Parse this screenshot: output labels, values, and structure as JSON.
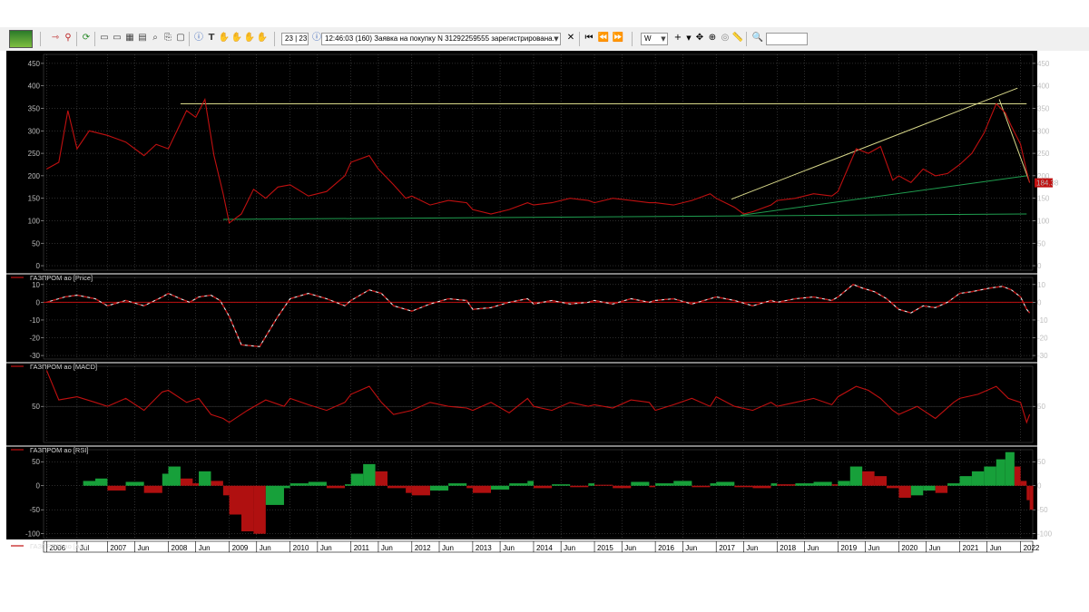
{
  "toolbar": {
    "icons": [
      "app-logo-icon",
      "arrow-right-icon",
      "link-icon",
      "refresh-icon",
      "window-icon",
      "window-icon",
      "table-icon",
      "chart-icon",
      "search-doc-icon",
      "export-icon",
      "info-icon",
      "text-icon",
      "hand-icon",
      "hand-icon",
      "hand-icon"
    ],
    "counter": "23 | 23",
    "status_message": "12:46:03  (160) Заявка на покупку N 31292259555 зарегистрирована.",
    "nav_icons": [
      "first-icon",
      "prev-icon",
      "next-icon"
    ],
    "period": "W",
    "tool_icons": [
      "crosshair-icon",
      "dropdown-icon",
      "move-icon",
      "target-icon",
      "circle-icon",
      "ruler-icon"
    ],
    "zoom_icon": "zoom-icon",
    "search_value": ""
  },
  "colors": {
    "background": "#000000",
    "price": "#c01010",
    "indicator": "#e8e8e8",
    "green_line": "#1f9d4f",
    "yellow_line": "#d8d88a",
    "ao_up": "#17a03a",
    "ao_down": "#b01010",
    "divider": "#d0d0d0"
  },
  "panels": [
    {
      "id": "price",
      "legend": "ГАЗПРОМ ао [Price]",
      "ticks": [
        0,
        50,
        100,
        150,
        200,
        250,
        300,
        350,
        400,
        450
      ],
      "ylim": [
        -10,
        470
      ],
      "last_price_label": "184.38"
    },
    {
      "id": "macd",
      "legend": "ГАЗПРОМ ао [MACD]",
      "ticks": [
        10,
        0,
        -10,
        -20,
        -30
      ],
      "ylim": [
        -32,
        14
      ]
    },
    {
      "id": "rsi",
      "legend": "ГАЗПРОМ ао [RSI]",
      "ticks": [
        50
      ],
      "ylim": [
        5,
        100
      ]
    },
    {
      "id": "ao",
      "legend": "ГАЗПРОМ ао [AO]",
      "ticks": [
        50,
        0,
        -50,
        -100
      ],
      "ylim": [
        -110,
        75
      ]
    }
  ],
  "chart_data": [
    {
      "type": "line",
      "title": "ГАЗПРОМ ао [Price]",
      "x_unit": "year",
      "x": [
        2006.0,
        2006.2,
        2006.35,
        2006.5,
        2006.7,
        2007.0,
        2007.3,
        2007.6,
        2007.8,
        2008.0,
        2008.3,
        2008.45,
        2008.6,
        2008.75,
        2008.9,
        2009.0,
        2009.2,
        2009.4,
        2009.6,
        2009.8,
        2010.0,
        2010.3,
        2010.6,
        2010.9,
        2011.0,
        2011.3,
        2011.45,
        2011.7,
        2011.9,
        2012.0,
        2012.3,
        2012.6,
        2012.9,
        2013.0,
        2013.3,
        2013.6,
        2013.9,
        2014.0,
        2014.3,
        2014.6,
        2014.9,
        2015.0,
        2015.3,
        2015.6,
        2015.9,
        2016.0,
        2016.3,
        2016.6,
        2016.9,
        2017.0,
        2017.3,
        2017.45,
        2017.6,
        2017.9,
        2018.0,
        2018.3,
        2018.6,
        2018.9,
        2019.0,
        2019.3,
        2019.5,
        2019.7,
        2019.9,
        2020.0,
        2020.2,
        2020.4,
        2020.6,
        2020.8,
        2021.0,
        2021.2,
        2021.4,
        2021.6,
        2021.75,
        2021.85,
        2022.0,
        2022.1,
        2022.15
      ],
      "series": [
        {
          "name": "ГАЗПРОМ ао [Price]",
          "values": [
            215,
            230,
            345,
            260,
            300,
            290,
            275,
            245,
            270,
            260,
            345,
            330,
            370,
            245,
            160,
            95,
            115,
            170,
            150,
            175,
            180,
            155,
            165,
            200,
            230,
            245,
            215,
            180,
            150,
            155,
            135,
            145,
            140,
            125,
            115,
            125,
            140,
            135,
            140,
            150,
            145,
            140,
            150,
            145,
            140,
            140,
            135,
            145,
            160,
            150,
            130,
            115,
            120,
            135,
            145,
            150,
            160,
            155,
            165,
            260,
            250,
            265,
            190,
            200,
            185,
            215,
            200,
            205,
            225,
            250,
            295,
            360,
            340,
            310,
            270,
            210,
            184.38
          ]
        }
      ],
      "trendlines": [
        {
          "color": "yellow",
          "points": [
            [
              2008.2,
              360
            ],
            [
              2022.1,
              360
            ]
          ]
        },
        {
          "color": "green",
          "points": [
            [
              2008.9,
              103
            ],
            [
              2022.1,
              115
            ]
          ]
        },
        {
          "color": "green",
          "points": [
            [
              2017.4,
              112
            ],
            [
              2022.1,
              200
            ]
          ]
        },
        {
          "color": "yellow",
          "points": [
            [
              2017.25,
              148
            ],
            [
              2021.95,
              395
            ]
          ]
        },
        {
          "color": "yellow",
          "points": [
            [
              2021.65,
              370
            ],
            [
              2022.15,
              185
            ]
          ]
        }
      ],
      "ylim": [
        -10,
        470
      ]
    },
    {
      "type": "line",
      "title": "ГАЗПРОМ ао [MACD]",
      "x": [
        2006.0,
        2006.3,
        2006.5,
        2006.8,
        2007.0,
        2007.3,
        2007.6,
        2007.9,
        2008.0,
        2008.2,
        2008.35,
        2008.5,
        2008.7,
        2008.85,
        2009.0,
        2009.2,
        2009.5,
        2009.8,
        2010.0,
        2010.3,
        2010.6,
        2010.9,
        2011.0,
        2011.3,
        2011.5,
        2011.7,
        2012.0,
        2012.3,
        2012.6,
        2012.9,
        2013.0,
        2013.3,
        2013.6,
        2013.9,
        2014.0,
        2014.3,
        2014.6,
        2014.9,
        2015.0,
        2015.3,
        2015.6,
        2015.9,
        2016.0,
        2016.3,
        2016.6,
        2016.9,
        2017.0,
        2017.3,
        2017.6,
        2017.9,
        2018.0,
        2018.3,
        2018.6,
        2018.9,
        2019.0,
        2019.25,
        2019.4,
        2019.6,
        2019.8,
        2020.0,
        2020.2,
        2020.4,
        2020.6,
        2020.8,
        2021.0,
        2021.2,
        2021.5,
        2021.7,
        2021.85,
        2022.0,
        2022.1,
        2022.15
      ],
      "series": [
        {
          "name": "ГАЗПРОМ ао [MACD]",
          "values": [
            0,
            3,
            4,
            2,
            -2,
            1,
            -2,
            3,
            5,
            2,
            0,
            3,
            4,
            1,
            -8,
            -24,
            -25,
            -8,
            2,
            5,
            2,
            -2,
            1,
            7,
            5,
            -2,
            -5,
            -1,
            2,
            1,
            -4,
            -3,
            0,
            2,
            -1,
            1,
            -1,
            0,
            1,
            -1,
            2,
            0,
            1,
            2,
            -1,
            2,
            3,
            1,
            -2,
            1,
            0,
            2,
            3,
            1,
            3,
            10,
            8,
            6,
            2,
            -4,
            -6,
            -2,
            -3,
            0,
            5,
            6,
            8,
            9,
            7,
            3,
            -4,
            -6
          ]
        }
      ],
      "ylim": [
        -32,
        14
      ]
    },
    {
      "type": "line",
      "title": "ГАЗПРОМ ао [RSI]",
      "x": [
        2006.0,
        2006.2,
        2006.5,
        2006.8,
        2007.0,
        2007.3,
        2007.6,
        2007.9,
        2008.0,
        2008.3,
        2008.5,
        2008.7,
        2008.9,
        2009.0,
        2009.3,
        2009.6,
        2009.9,
        2010.0,
        2010.3,
        2010.6,
        2010.9,
        2011.0,
        2011.3,
        2011.5,
        2011.7,
        2012.0,
        2012.3,
        2012.6,
        2012.9,
        2013.0,
        2013.3,
        2013.6,
        2013.9,
        2014.0,
        2014.3,
        2014.6,
        2014.9,
        2015.0,
        2015.3,
        2015.6,
        2015.9,
        2016.0,
        2016.3,
        2016.6,
        2016.9,
        2017.0,
        2017.3,
        2017.6,
        2017.9,
        2018.0,
        2018.3,
        2018.6,
        2018.9,
        2019.0,
        2019.3,
        2019.5,
        2019.7,
        2019.9,
        2020.0,
        2020.3,
        2020.6,
        2020.9,
        2021.0,
        2021.3,
        2021.6,
        2021.8,
        2022.0,
        2022.1,
        2022.15
      ],
      "series": [
        {
          "name": "ГАЗПРОМ ао [RSI]",
          "values": [
            95,
            58,
            62,
            55,
            50,
            60,
            45,
            68,
            70,
            55,
            60,
            40,
            35,
            30,
            45,
            58,
            50,
            60,
            52,
            45,
            55,
            65,
            75,
            55,
            40,
            45,
            55,
            50,
            48,
            45,
            55,
            42,
            60,
            50,
            45,
            55,
            50,
            52,
            48,
            58,
            55,
            45,
            52,
            60,
            50,
            62,
            50,
            45,
            55,
            50,
            55,
            60,
            52,
            62,
            75,
            70,
            60,
            45,
            40,
            50,
            35,
            55,
            60,
            65,
            75,
            60,
            55,
            30,
            40
          ]
        }
      ],
      "ylim": [
        5,
        100
      ]
    },
    {
      "type": "bar",
      "title": "ГАЗПРОМ ао [AO]",
      "x": [
        2006.6,
        2006.8,
        2007.0,
        2007.3,
        2007.6,
        2007.9,
        2008.0,
        2008.2,
        2008.4,
        2008.5,
        2008.7,
        2008.9,
        2009.0,
        2009.2,
        2009.4,
        2009.6,
        2009.9,
        2010.0,
        2010.3,
        2010.6,
        2010.9,
        2011.0,
        2011.2,
        2011.4,
        2011.6,
        2011.9,
        2012.0,
        2012.3,
        2012.6,
        2012.9,
        2013.0,
        2013.3,
        2013.6,
        2013.9,
        2014.0,
        2014.3,
        2014.6,
        2014.9,
        2015.0,
        2015.3,
        2015.6,
        2015.9,
        2016.0,
        2016.3,
        2016.6,
        2016.9,
        2017.0,
        2017.3,
        2017.6,
        2017.9,
        2018.0,
        2018.3,
        2018.6,
        2018.9,
        2019.0,
        2019.2,
        2019.4,
        2019.6,
        2019.8,
        2020.0,
        2020.2,
        2020.4,
        2020.6,
        2020.8,
        2021.0,
        2021.2,
        2021.4,
        2021.6,
        2021.75,
        2021.9,
        2022.0,
        2022.1,
        2022.15
      ],
      "values": [
        10,
        15,
        -10,
        8,
        -15,
        25,
        40,
        15,
        5,
        30,
        10,
        -20,
        -60,
        -95,
        -100,
        -40,
        -5,
        5,
        8,
        -5,
        3,
        25,
        45,
        30,
        -5,
        -15,
        -20,
        -10,
        5,
        -5,
        -15,
        -8,
        5,
        10,
        -5,
        3,
        -3,
        5,
        2,
        -5,
        8,
        -3,
        5,
        10,
        -3,
        5,
        8,
        -3,
        -5,
        5,
        3,
        5,
        8,
        3,
        10,
        40,
        30,
        20,
        -5,
        -25,
        -20,
        -10,
        -15,
        5,
        20,
        30,
        40,
        55,
        70,
        40,
        10,
        -30,
        -50
      ],
      "ylim": [
        -110,
        75
      ]
    }
  ],
  "xaxis": {
    "labels": [
      "2006",
      "Jul",
      "2007",
      "Jun",
      "2008",
      "Jun",
      "2009",
      "Jun",
      "2010",
      "Jun",
      "2011",
      "Jun",
      "2012",
      "Jun",
      "2013",
      "Jun",
      "2014",
      "Jun",
      "2015",
      "Jun",
      "2016",
      "Jun",
      "2017",
      "Jun",
      "2018",
      "Jun",
      "2019",
      "Jun",
      "2020",
      "Jun",
      "2021",
      "Jun",
      "2022"
    ],
    "positions": [
      2006.0,
      2006.5,
      2007.0,
      2007.45,
      2008.0,
      2008.45,
      2009.0,
      2009.45,
      2010.0,
      2010.45,
      2011.0,
      2011.45,
      2012.0,
      2012.45,
      2013.0,
      2013.45,
      2014.0,
      2014.45,
      2015.0,
      2015.45,
      2016.0,
      2016.45,
      2017.0,
      2017.45,
      2018.0,
      2018.45,
      2019.0,
      2019.45,
      2020.0,
      2020.45,
      2021.0,
      2021.45,
      2022.0
    ],
    "range": [
      2005.95,
      2022.2
    ]
  }
}
